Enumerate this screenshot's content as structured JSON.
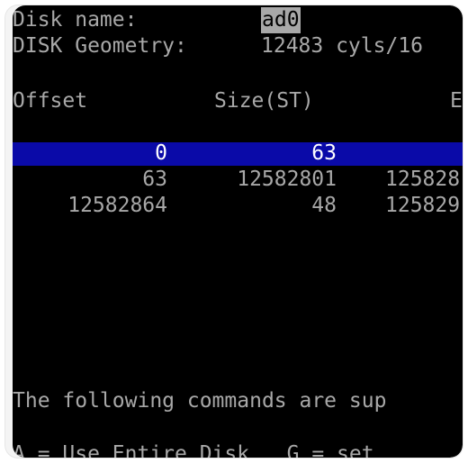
{
  "header": {
    "disk_name_label": "Disk name:",
    "disk_name_value": "ad0",
    "geometry_label": "DISK Geometry:",
    "geometry_value": "12483 cyls/16"
  },
  "columns": {
    "offset": "Offset",
    "size": "Size(ST)",
    "end_partial": "E"
  },
  "rows": [
    {
      "offset": "0",
      "size": "63",
      "end": "",
      "selected": true
    },
    {
      "offset": "63",
      "size": "12582801",
      "end": "125828",
      "selected": false
    },
    {
      "offset": "12582864",
      "size": "48",
      "end": "125829",
      "selected": false
    }
  ],
  "footer": {
    "commands_text": "The following commands are sup",
    "command_hint": "A = Use Entire Disk   G = set"
  },
  "colors": {
    "background": "#000000",
    "text": "#a8a8a8",
    "selection": "#0a0aa8",
    "selection_text": "#ffffff"
  }
}
